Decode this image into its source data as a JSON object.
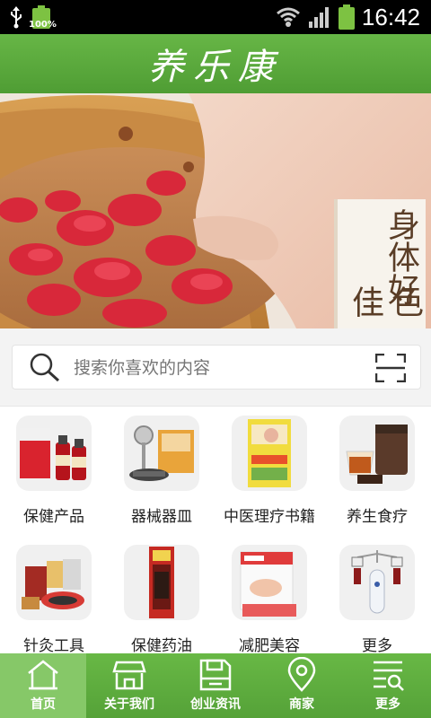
{
  "status_bar": {
    "time": "16:42",
    "battery_percent_label": "100%",
    "icons": [
      "usb-icon",
      "battery-icon",
      "wifi-icon",
      "signal-icon",
      "battery-icon"
    ]
  },
  "header": {
    "title": "养乐康"
  },
  "banner": {
    "slogan_line1": "身体好",
    "slogan_line2": "气色佳",
    "slide_count": 6,
    "active_slide": 6
  },
  "search": {
    "placeholder": "搜索你喜欢的内容"
  },
  "categories": [
    {
      "label": "保健产品"
    },
    {
      "label": "器械器皿"
    },
    {
      "label": "中医理疗书籍"
    },
    {
      "label": "养生食疗"
    },
    {
      "label": "针灸工具"
    },
    {
      "label": "保健药油"
    },
    {
      "label": "减肥美容"
    },
    {
      "label": "更多"
    }
  ],
  "tabs": [
    {
      "label": "首页",
      "icon": "home-icon",
      "active": true
    },
    {
      "label": "关于我们",
      "icon": "shop-icon",
      "active": false
    },
    {
      "label": "创业资讯",
      "icon": "save-icon",
      "active": false
    },
    {
      "label": "商家",
      "icon": "location-icon",
      "active": false
    },
    {
      "label": "更多",
      "icon": "menu-search-icon",
      "active": false
    }
  ],
  "colors": {
    "primary_green": "#5aa83c",
    "tab_active": "#86c868"
  }
}
